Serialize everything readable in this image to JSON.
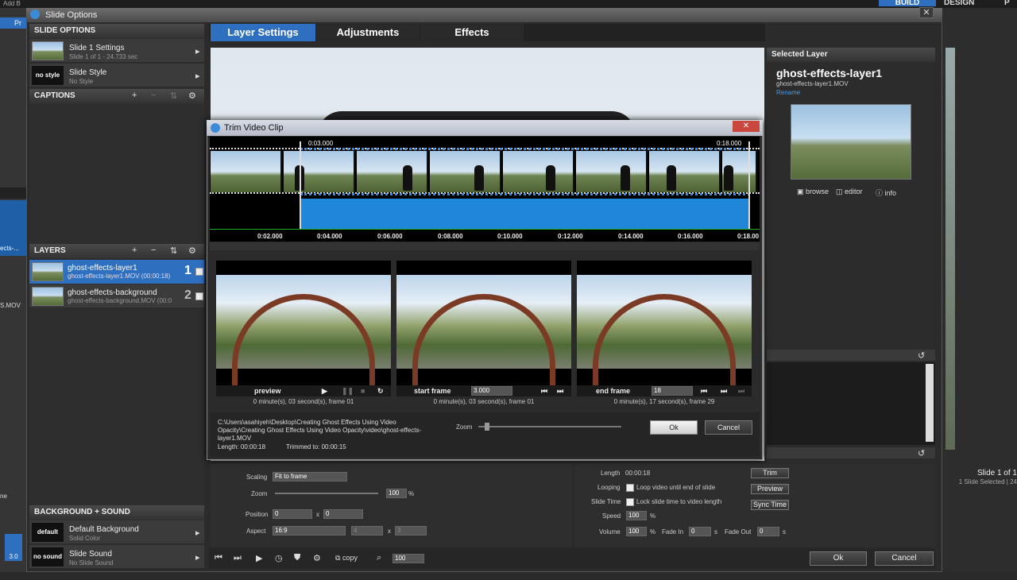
{
  "app": {
    "top_mode": "BUILD",
    "top_mode2": "DESIGN",
    "top_mode3": "P",
    "left_label": "Add B",
    "left_label2": "Pr",
    "left_label3": "ects-...",
    "left_label4": "S.MOV",
    "left_label5": "ne",
    "right_slide": "Slide 1 of 1",
    "right_selected": "1 Slide Selected  |  24",
    "version": "3.0"
  },
  "window": {
    "title": "Slide Options",
    "close": "✕"
  },
  "sidebar": {
    "slide_options_header": "SLIDE OPTIONS",
    "items": [
      {
        "title": "Slide 1 Settings",
        "sub": "Slide 1 of 1 - 24.733 sec"
      },
      {
        "title": "Slide Style",
        "sub": "No Style",
        "thumb": "no style"
      }
    ],
    "captions_header": "CAPTIONS",
    "layers_header": "LAYERS",
    "layers": [
      {
        "name": "ghost-effects-layer1",
        "file": "ghost-effects-layer1.MOV (00:00:18)",
        "num": "1"
      },
      {
        "name": "ghost-effects-background",
        "file": "ghost-effects-background.MOV (00:0",
        "num": "2"
      }
    ],
    "bg_header": "BACKGROUND + SOUND",
    "bg_items": [
      {
        "thumb": "default",
        "title": "Default Background",
        "sub": "Solid Color"
      },
      {
        "thumb": "no sound",
        "title": "Slide Sound",
        "sub": "No Slide Sound"
      }
    ]
  },
  "tabs": [
    "Layer Settings",
    "Adjustments",
    "Effects"
  ],
  "selected_layer": {
    "header": "Selected Layer",
    "name": "ghost-effects-layer1",
    "file": "ghost-effects-layer1.MOV",
    "rename": "Rename",
    "browse": "browse",
    "editor": "editor",
    "info": "info"
  },
  "trim_dialog": {
    "title": "Trim Video Clip",
    "start_marker": "0:03.000",
    "end_marker": "0:18.000",
    "ticks": [
      "0:02.000",
      "0:04.000",
      "0:06.000",
      "0:08.000",
      "0:10.000",
      "0:12.000",
      "0:14.000",
      "0:16.000",
      "0:18.00"
    ],
    "preview_label": "preview",
    "preview_info": "0 minute(s), 03 second(s), frame 01",
    "start_label": "start frame",
    "start_value": "3.000",
    "start_info": "0 minute(s), 03 second(s), frame 01",
    "end_label": "end frame",
    "end_value": "18",
    "end_info": "0 minute(s), 17 second(s), frame 29",
    "path": "C:\\Users\\asahiyeh\\Desktop\\Creating Ghost Effects Using Video Opacity\\Creating Ghost Effects Using Video Opacity\\video\\ghost-effects-layer1.MOV",
    "length": "Length: 00:00:18",
    "trimmed": "Trimmed to: 00:00:15",
    "zoom_label": "Zoom",
    "ok": "Ok",
    "cancel": "Cancel"
  },
  "layer_props": {
    "scaling_label": "Scaling",
    "scaling_value": "Fit to frame",
    "zoom_label": "Zoom",
    "zoom_value": "100",
    "pct": "%",
    "position_label": "Position",
    "pos_x": "0",
    "x": "x",
    "pos_y": "0",
    "aspect_label": "Aspect",
    "aspect_value": "16:9",
    "aspect_w": "4",
    "aspect_h": "3"
  },
  "video_props": {
    "length_label": "Length",
    "length_value": "00:00:18",
    "trim": "Trim",
    "looping_label": "Looping",
    "looping_text": "Loop video until end of slide",
    "preview": "Preview",
    "slidetime_label": "Slide Time",
    "slidetime_text": "Lock slide time to video length",
    "sync": "Sync Time",
    "speed_label": "Speed",
    "speed_value": "100",
    "pct": "%",
    "volume_label": "Volume",
    "volume_value": "100",
    "fadein_label": "Fade In",
    "fadein_value": "0",
    "s": "s",
    "fadeout_label": "Fade Out",
    "fadeout_value": "0"
  },
  "bottom_bar": {
    "copy": "copy",
    "zoom_value": "100",
    "ok": "Ok",
    "cancel": "Cancel"
  }
}
